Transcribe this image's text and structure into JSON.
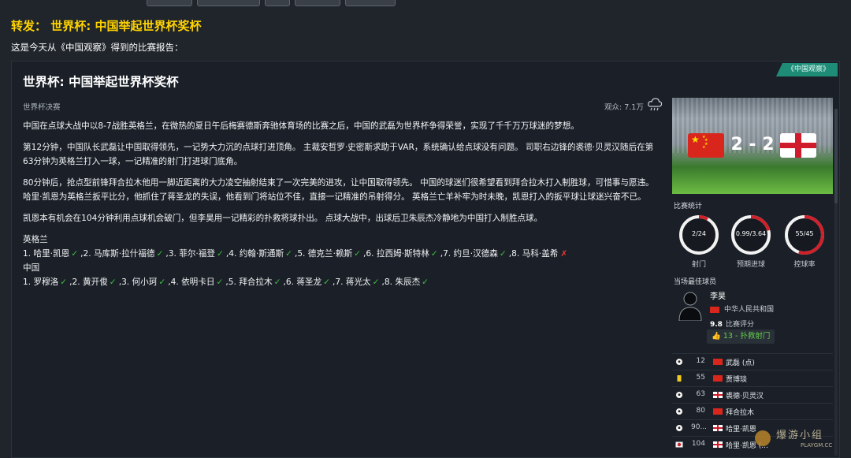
{
  "headline": "转发： 世界杯: 中国举起世界杯奖杯",
  "intro": "这是今天从《中国观察》得到的比赛报告：",
  "card": {
    "source_badge": "《中国观察》",
    "title": "世界杯: 中国举起世界杯奖杯",
    "subtitle": "世界杯决赛",
    "attendance": "观众: 7.1万",
    "weather_icon": "rain-cloud-icon",
    "paragraphs": [
      "中国在点球大战中以8-7战胜英格兰，在微热的夏日午后梅赛德斯奔驰体育场的比赛之后，中国的武磊为世界杯争得荣誉，实现了千千万万球迷的梦想。",
      "第12分钟，中国队长武磊让中国取得领先，一记势大力沉的点球打进顶角。 主裁安哲罗·史密斯求助于VAR，系统确认给点球没有问题。 司职右边锋的裘德·贝灵汉随后在第63分钟为英格兰打入一球，一记精准的射门打进球门底角。",
      "80分钟后，抢点型前锋拜合拉木他用一脚近距离的大力凌空抽射结束了一次完美的进攻，让中国取得领先。 中国的球迷们很希望看到拜合拉木打入制胜球，可惜事与愿违。 哈里·凯恩为英格兰扳平比分，他抓住了蒋圣龙的失误，他看到门将站位不佳，直接一记精准的吊射得分。 英格兰亡羊补牢为时未晚，凯恩打入的扳平球让球迷兴奋不已。",
      "凯恩本有机会在104分钟利用点球机会破门，但李昊用一记精彩的扑救将球扑出。 点球大战中，出球后卫朱辰杰冷静地为中国打入制胜点球。"
    ],
    "lineups": [
      {
        "team": "英格兰",
        "players": [
          {
            "text": "1. 哈里·凯恩",
            "mark": "✓"
          },
          {
            "text": "2. 马库斯·拉什福德",
            "mark": "✓"
          },
          {
            "text": "3. 菲尔·福登",
            "mark": "✓"
          },
          {
            "text": "4. 约翰·斯通斯",
            "mark": "✓"
          },
          {
            "text": "5. 德克兰·赖斯",
            "mark": "✓"
          },
          {
            "text": "6. 拉西姆·斯特林",
            "mark": "✓"
          },
          {
            "text": "7. 约旦·汉德森",
            "mark": "✓"
          },
          {
            "text": "8. 马科·盖希",
            "mark": "✗"
          }
        ]
      },
      {
        "team": "中国",
        "players": [
          {
            "text": "1. 罗穆洛",
            "mark": "✓"
          },
          {
            "text": "2. 黄开俊",
            "mark": "✓"
          },
          {
            "text": "3. 何小珂",
            "mark": "✓"
          },
          {
            "text": "4. 依明卡日",
            "mark": "✓"
          },
          {
            "text": "5. 拜合拉木",
            "mark": "✓"
          },
          {
            "text": "6. 蒋圣龙",
            "mark": "✓"
          },
          {
            "text": "7. 蒋光太",
            "mark": "✓"
          },
          {
            "text": "8. 朱辰杰",
            "mark": "✓"
          }
        ]
      }
    ]
  },
  "match": {
    "score": "2 - 2",
    "home_flag": "china-flag-icon",
    "away_flag": "england-flag-icon"
  },
  "stats": {
    "title": "比赛统计",
    "items": [
      {
        "value": "2/24",
        "label": "射门",
        "fraction": 0.08
      },
      {
        "value": "0.99/3.64",
        "label": "预期进球",
        "fraction": 0.21
      },
      {
        "value": "55/45",
        "label": "控球率",
        "fraction": 0.55
      }
    ],
    "ring_colors": {
      "home": "#d0202a",
      "away": "#f2f2f2"
    }
  },
  "best_player": {
    "title": "当场最佳球员",
    "name": "李昊",
    "nation": "中华人民共和国",
    "rating": "9.8",
    "rating_label": "比赛评分",
    "moment": "13 - 扑救射门"
  },
  "events": [
    {
      "icon": "football-icon",
      "minute": "12",
      "team": "cn",
      "name": "武磊 (点)"
    },
    {
      "icon": "yellow-card-icon",
      "minute": "55",
      "team": "cn",
      "name": "贾博琰"
    },
    {
      "icon": "football-icon",
      "minute": "63",
      "team": "en",
      "name": "裘德·贝灵汉"
    },
    {
      "icon": "football-icon",
      "minute": "80",
      "team": "cn",
      "name": "拜合拉木"
    },
    {
      "icon": "football-icon",
      "minute": "90...",
      "team": "en",
      "name": "哈里·凯恩"
    },
    {
      "icon": "missed-penalty-icon",
      "minute": "104",
      "team": "en",
      "name": "哈里·凯恩 (..."
    }
  ],
  "watermark": {
    "text": "爆游小组",
    "url": "PLAYGM.CC"
  }
}
